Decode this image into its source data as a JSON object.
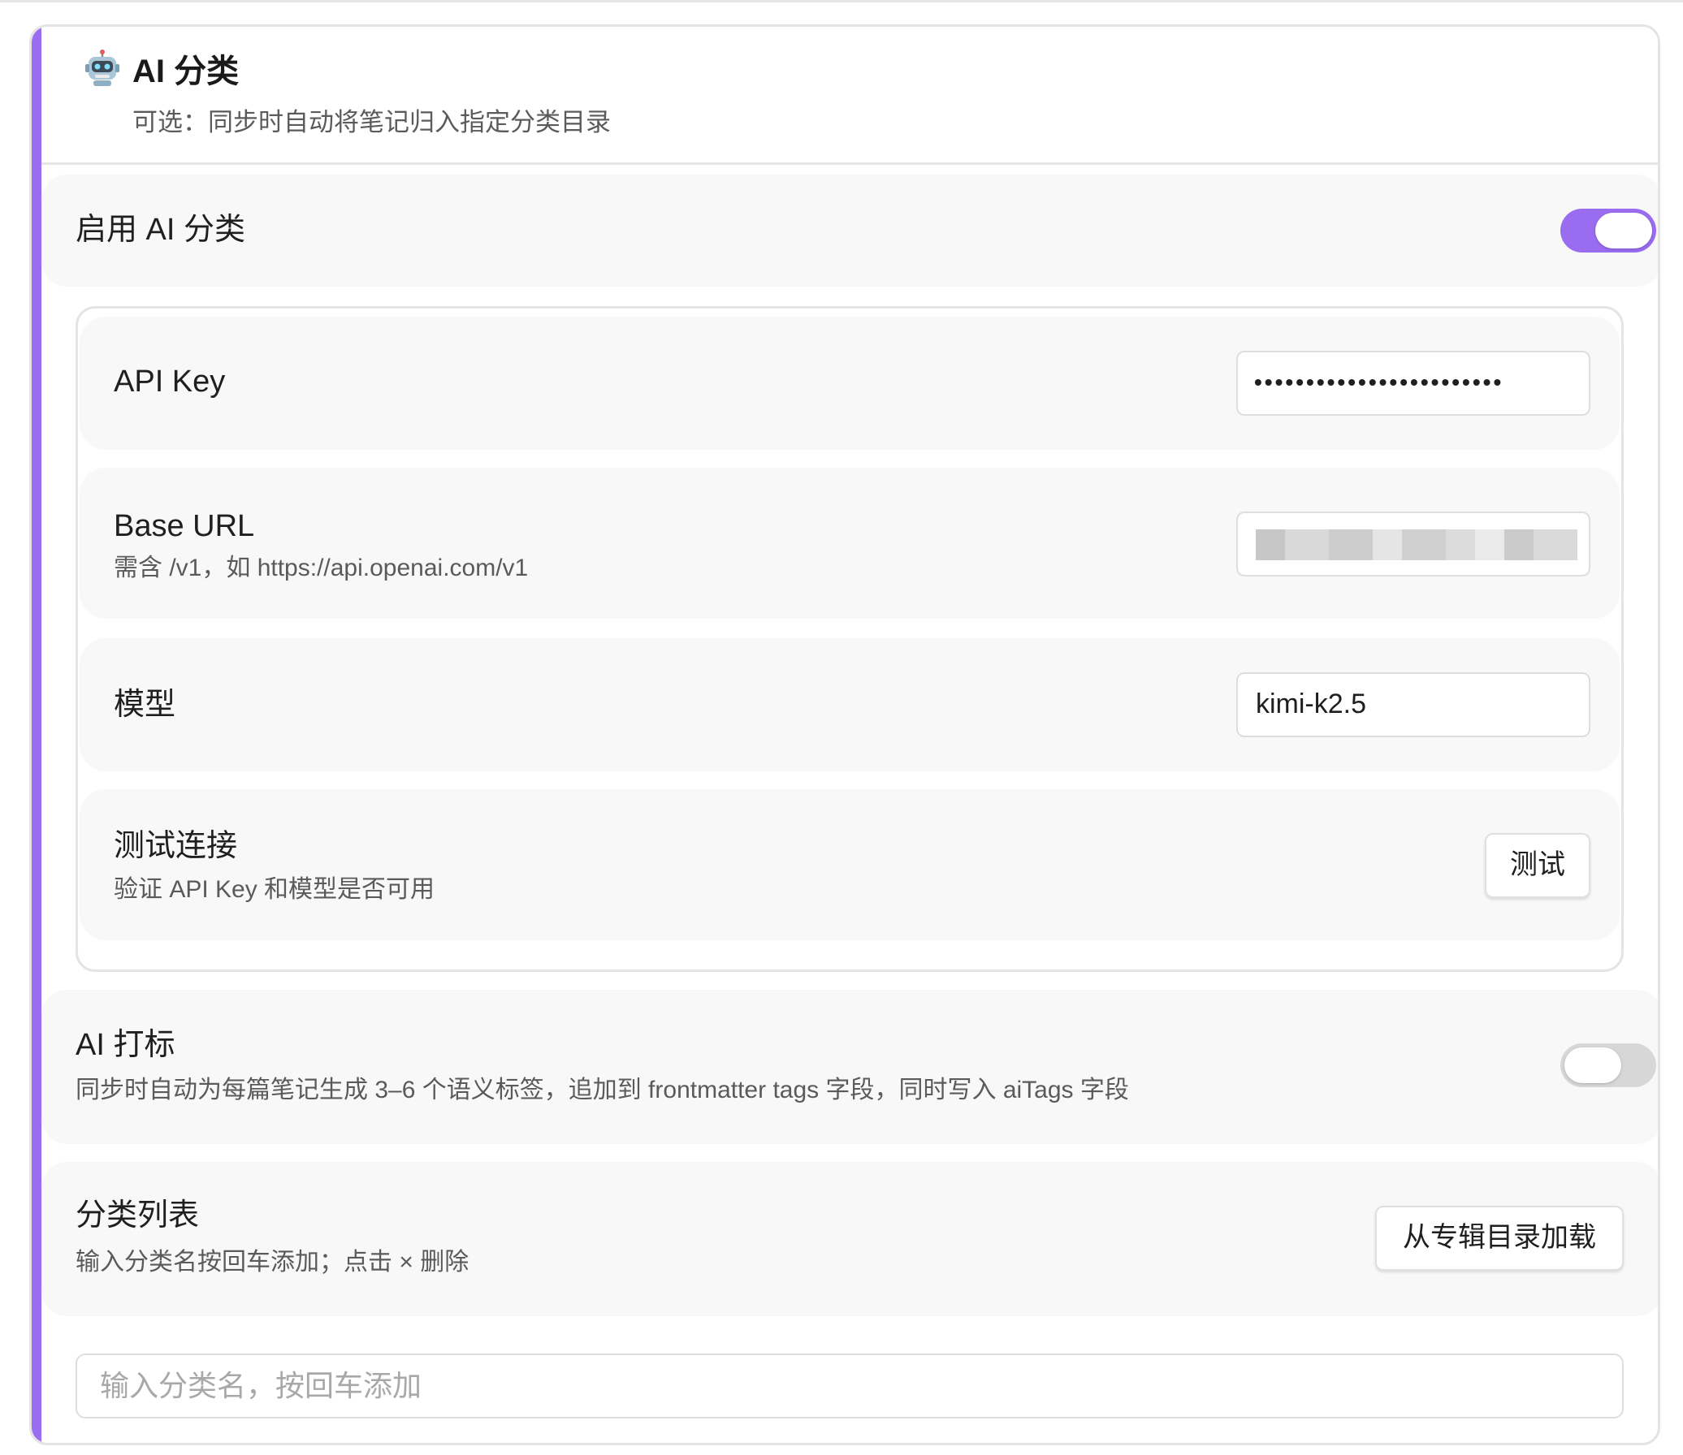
{
  "header": {
    "icon": "robot-icon",
    "title": "AI 分类",
    "subtitle": "可选：同步时自动将笔记归入指定分类目录"
  },
  "enable_ai": {
    "label": "启用 AI 分类",
    "enabled": true
  },
  "accent_color": "#9a6cf0",
  "api_key": {
    "label": "API Key",
    "value": "••••••••••••••••••••••••"
  },
  "base_url": {
    "label": "Base URL",
    "description": "需含 /v1，如 https://api.openai.com/v1"
  },
  "model": {
    "label": "模型",
    "value": "kimi-k2.5"
  },
  "test_connection": {
    "label": "测试连接",
    "description": "验证 API Key 和模型是否可用",
    "button": "测试"
  },
  "ai_tagging": {
    "label": "AI 打标",
    "description": "同步时自动为每篇笔记生成 3–6 个语义标签，追加到 frontmatter tags 字段，同时写入 aiTags 字段",
    "enabled": false
  },
  "category_list": {
    "label": "分类列表",
    "description": "输入分类名按回车添加；点击 × 删除",
    "button": "从专辑目录加载",
    "input_placeholder": "输入分类名，按回车添加"
  }
}
